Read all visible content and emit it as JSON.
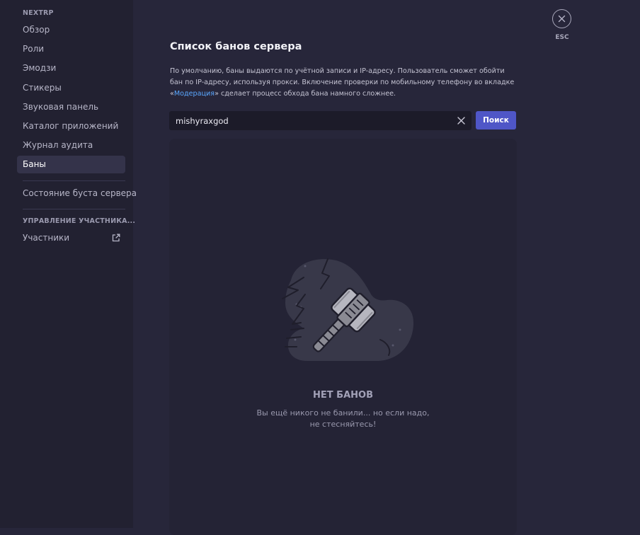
{
  "sidebar": {
    "server_name": "NEXTRP",
    "items": [
      {
        "label": "Обзор"
      },
      {
        "label": "Роли"
      },
      {
        "label": "Эмодзи"
      },
      {
        "label": "Стикеры"
      },
      {
        "label": "Звуковая панель"
      },
      {
        "label": "Каталог приложений"
      },
      {
        "label": "Журнал аудита"
      },
      {
        "label": "Баны",
        "active": true
      }
    ],
    "boost_item": "Состояние буста сервера",
    "members_section": "УПРАВЛЕНИЕ УЧАСТНИКА...",
    "members_item": "Участники",
    "members_item_icon": "external-link-icon"
  },
  "close": {
    "icon": "close-icon",
    "label": "ESC"
  },
  "content": {
    "title": "Список банов сервера",
    "description_prefix": "По умолчанию, баны выдаются по учётной записи и IP-адресу. Пользователь сможет обойти бан по IP-адресу, используя прокси. Включение проверки по мобильному телефону во вкладке «",
    "description_link": "Модерация",
    "description_suffix": "» сделает процесс обхода бана намного сложнее.",
    "search": {
      "value": "mishyraxgod",
      "clear_icon": "clear-icon",
      "button_label": "Поиск"
    },
    "empty_state": {
      "illustration": "ban-hammer-illustration",
      "title": "НЕТ БАНОВ",
      "text": "Вы ещё никого не банили... но если надо, не стесняйтесь!"
    }
  },
  "colors": {
    "background": "#27263a",
    "sidebar": "#222131",
    "accent": "#4f56c7",
    "link": "#5ba8ff"
  }
}
